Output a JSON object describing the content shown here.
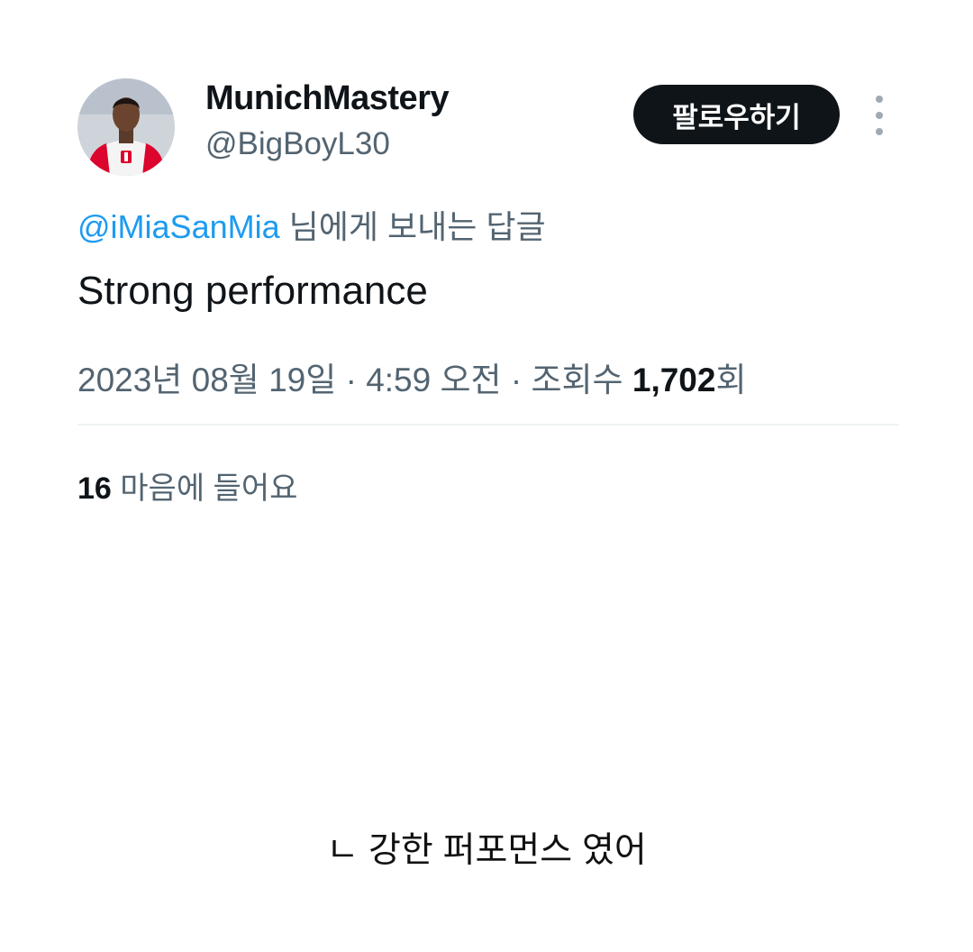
{
  "tweet": {
    "display_name": "MunichMastery",
    "handle": "@BigBoyL30",
    "follow_label": "팔로우하기",
    "reply_mention": "@iMiaSanMia",
    "reply_suffix": " 님에게 보내는 답글",
    "text": "Strong performance",
    "date": "2023년 08월 19일",
    "separator": " · ",
    "time": "4:59 오전",
    "views_label": "조회수 ",
    "views_count": "1,702",
    "views_unit": "회",
    "likes_count": "16",
    "likes_label": " 마음에 들어요"
  },
  "caption": "ㄴ 강한 퍼포먼스 였어",
  "icons": {
    "avatar": "player-avatar",
    "more": "more-vertical-icon"
  },
  "colors": {
    "text_primary": "#0f1419",
    "text_secondary": "#536471",
    "mention_blue": "#1d9bf0",
    "follow_button_bg": "#0f1419",
    "jersey_red": "#dc052d"
  }
}
